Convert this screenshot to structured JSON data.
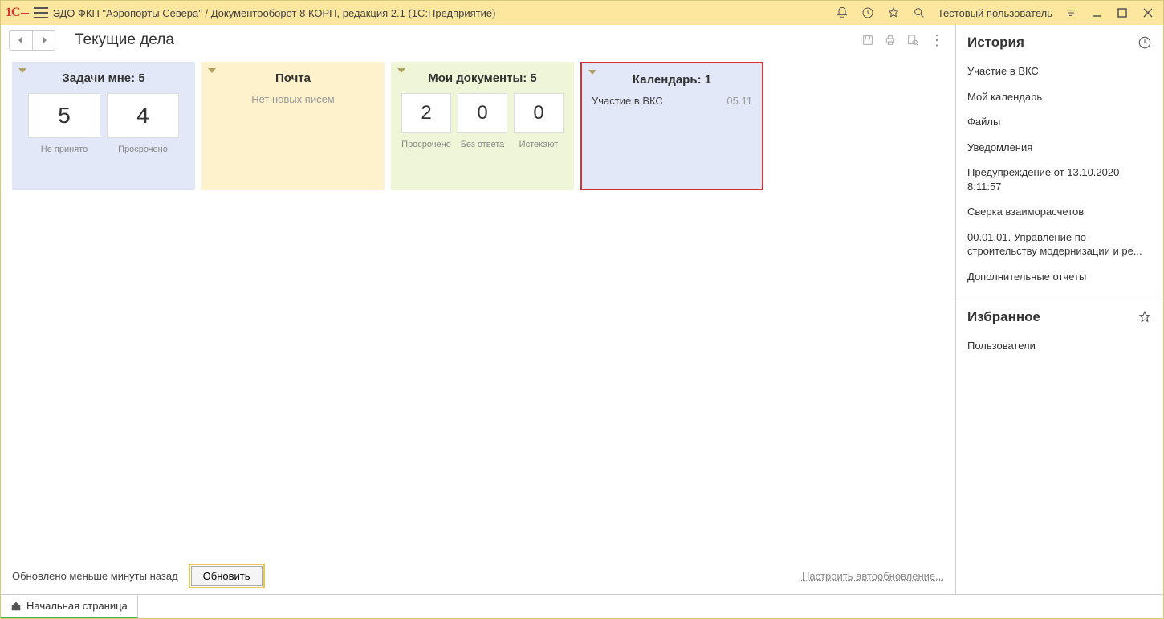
{
  "titlebar": {
    "app_title": "ЭДО ФКП \"Аэропорты Севера\" / Документооборот 8 КОРП, редакция 2.1  (1С:Предприятие)",
    "user": "Тестовый пользователь"
  },
  "page": {
    "title": "Текущие дела"
  },
  "widgets": {
    "tasks": {
      "title": "Задачи мне: 5",
      "not_accepted": {
        "value": "5",
        "label": "Не принято"
      },
      "overdue": {
        "value": "4",
        "label": "Просрочено"
      }
    },
    "mail": {
      "title": "Почта",
      "empty_text": "Нет новых писем"
    },
    "mydocs": {
      "title": "Мои документы: 5",
      "overdue": {
        "value": "2",
        "label": "Просрочено"
      },
      "no_reply": {
        "value": "0",
        "label": "Без ответа"
      },
      "expiring": {
        "value": "0",
        "label": "Истекают"
      }
    },
    "calendar": {
      "title": "Календарь: 1",
      "item": {
        "text": "Участие в ВКС",
        "date": "05.11"
      }
    }
  },
  "bottom": {
    "updated": "Обновлено меньше минуты назад",
    "refresh": "Обновить",
    "auto_link": "Настроить автообновление..."
  },
  "side": {
    "history_title": "История",
    "history": [
      "Участие в ВКС",
      "Мой календарь",
      "Файлы",
      "Уведомления",
      "Предупреждение от 13.10.2020 8:11:57",
      "Сверка взаиморасчетов",
      "00.01.01. Управление по строительству модернизации и ре...",
      "Дополнительные отчеты"
    ],
    "fav_title": "Избранное",
    "favorites": [
      "Пользователи"
    ]
  },
  "tabs": {
    "home": "Начальная страница"
  }
}
